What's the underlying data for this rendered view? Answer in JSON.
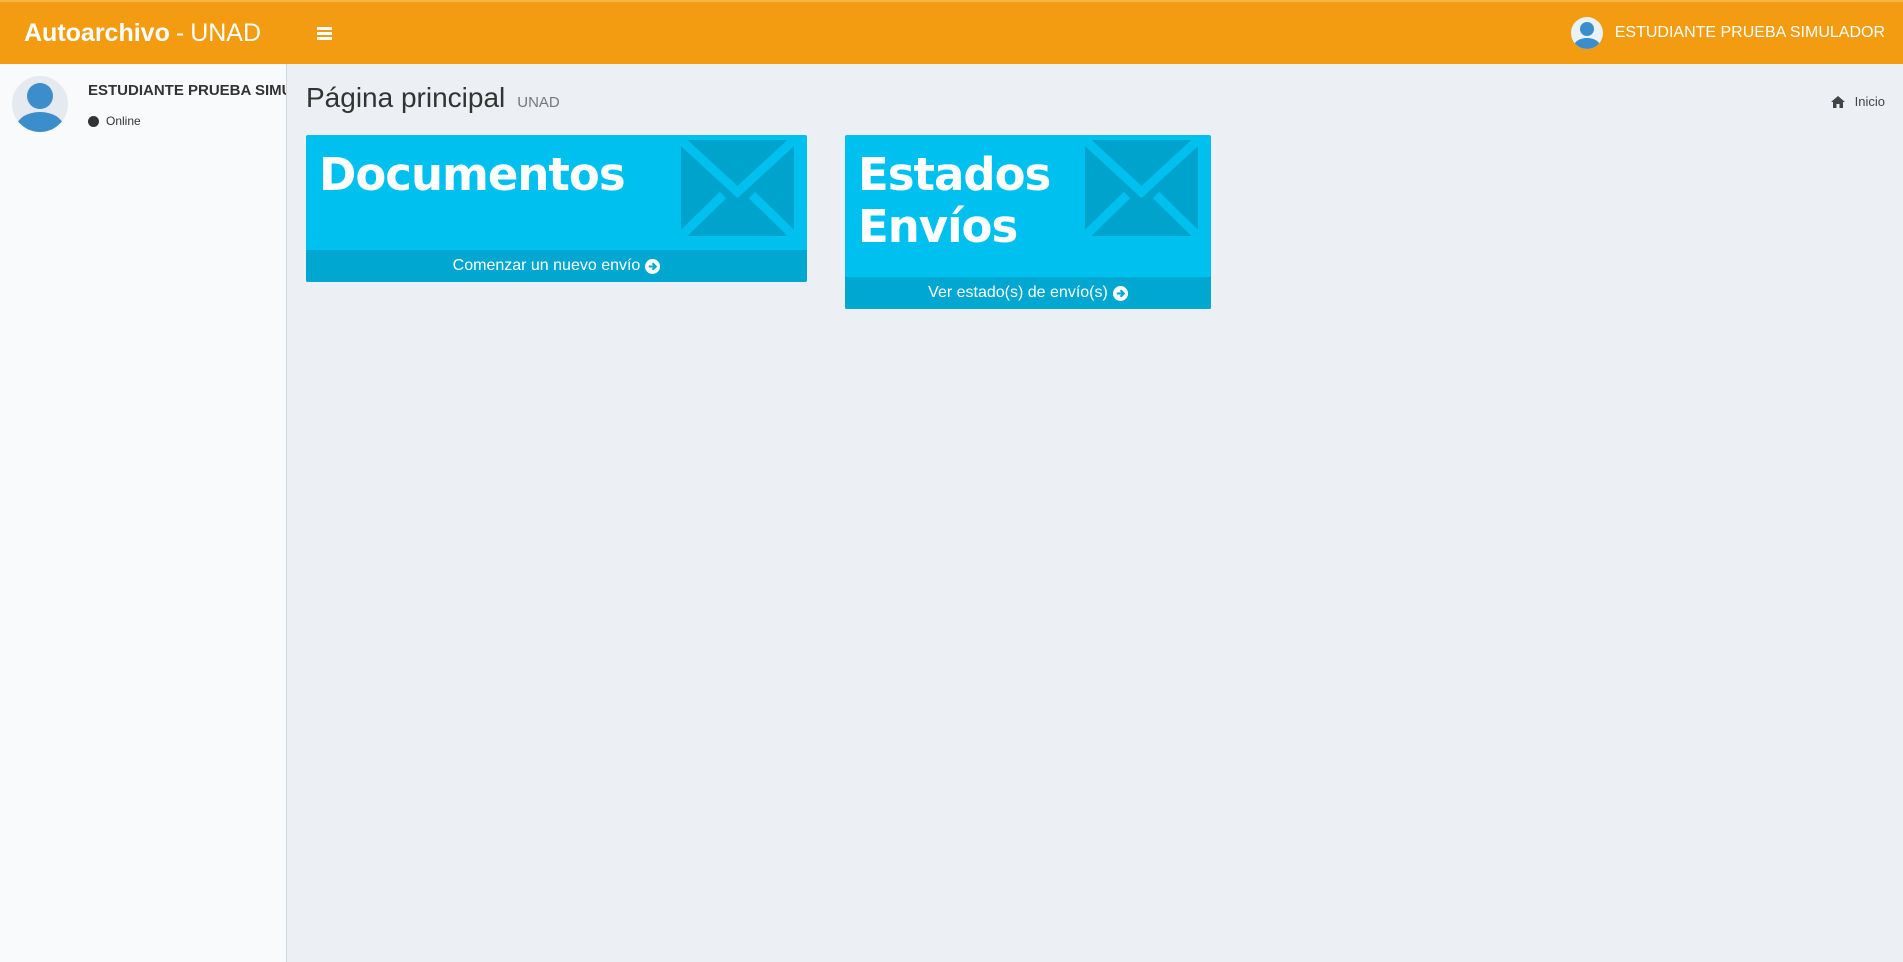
{
  "header": {
    "logo_bold": "Autoarchivo",
    "logo_sep": "-",
    "logo_light": "UNAD",
    "user_name": "ESTUDIANTE PRUEBA SIMULADOR"
  },
  "sidebar": {
    "user_name": "ESTUDIANTE PRUEBA SIMULADOR",
    "status": "Online"
  },
  "content": {
    "title": "Página principal",
    "subtitle": "UNAD",
    "breadcrumb": "Inicio"
  },
  "boxes": [
    {
      "title_line1": "Documentos",
      "title_line2": "",
      "footer": "Comenzar un nuevo envío",
      "icon": "envelope-icon"
    },
    {
      "title_line1": "Estados",
      "title_line2": "Envíos",
      "footer": "Ver estado(s) de envío(s)",
      "icon": "envelope-icon"
    }
  ],
  "colors": {
    "navbar": "#f39c12",
    "box_bg": "#00c0ef",
    "box_footer": "#00a7d0",
    "content_bg": "#ecf0f5"
  }
}
